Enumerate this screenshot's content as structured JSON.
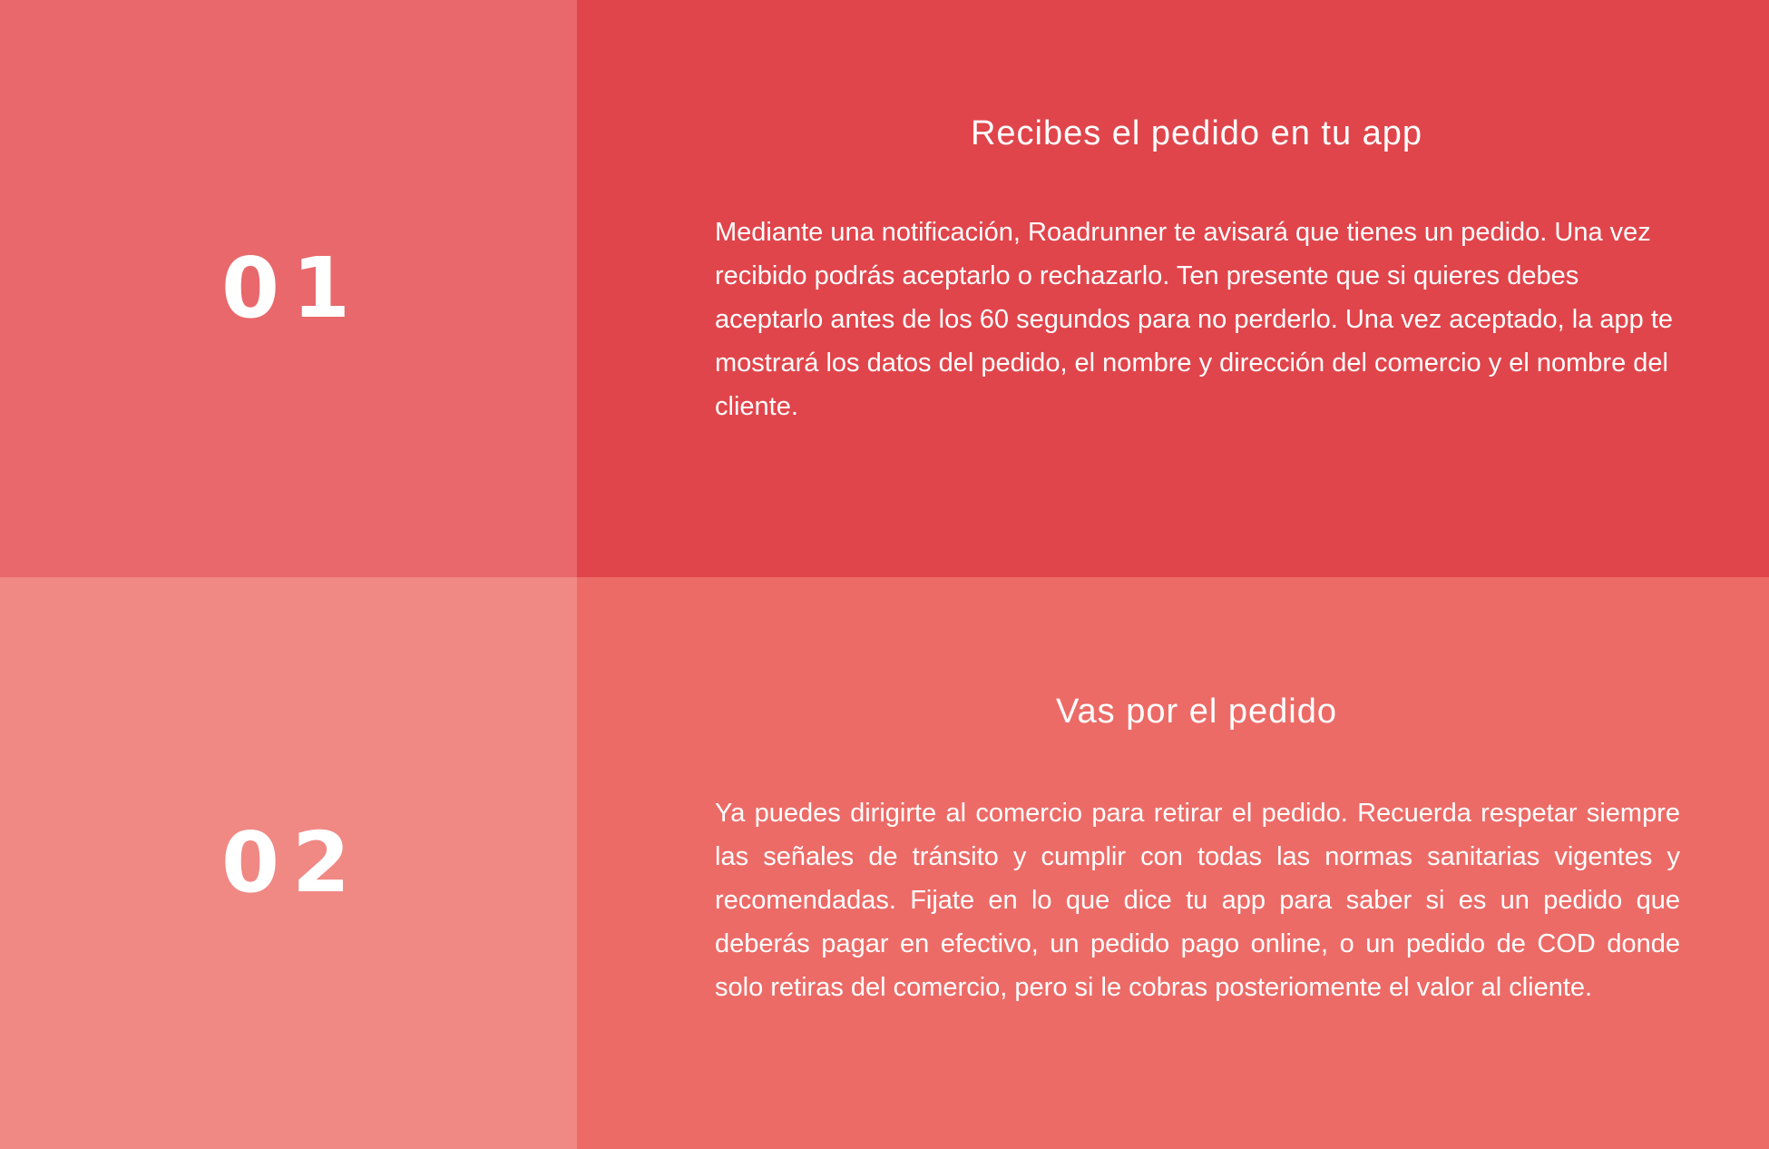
{
  "colors": {
    "row1_left": "#e8686c",
    "row1_right": "#e0454b",
    "row2_left": "#f08884",
    "row2_right": "#ec6b67",
    "text": "#ffffff"
  },
  "steps": [
    {
      "number": "01",
      "title": "Recibes el pedido en tu app",
      "description": "Mediante una notificación, Roadrunner te avisará que tienes un pedido. Una vez recibido podrás aceptarlo o rechazarlo. Ten presente que si quieres debes aceptarlo antes de los 60 segundos para no perderlo. Una vez aceptado, la app te mostrará los datos del pedido, el nombre y dirección del comercio y el nombre del cliente."
    },
    {
      "number": "02",
      "title": "Vas por el pedido",
      "description": "Ya puedes dirigirte al comercio para retirar el pedido. Recuerda respetar siempre las señales de tránsito y cumplir con todas las normas sanitarias vigentes y recomendadas. Fijate en lo que dice tu app para saber si es un pedido que deberás pagar en efectivo, un pedido pago online, o un pedido de COD donde solo retiras del comercio, pero si le cobras posteriomente el valor al cliente."
    }
  ]
}
